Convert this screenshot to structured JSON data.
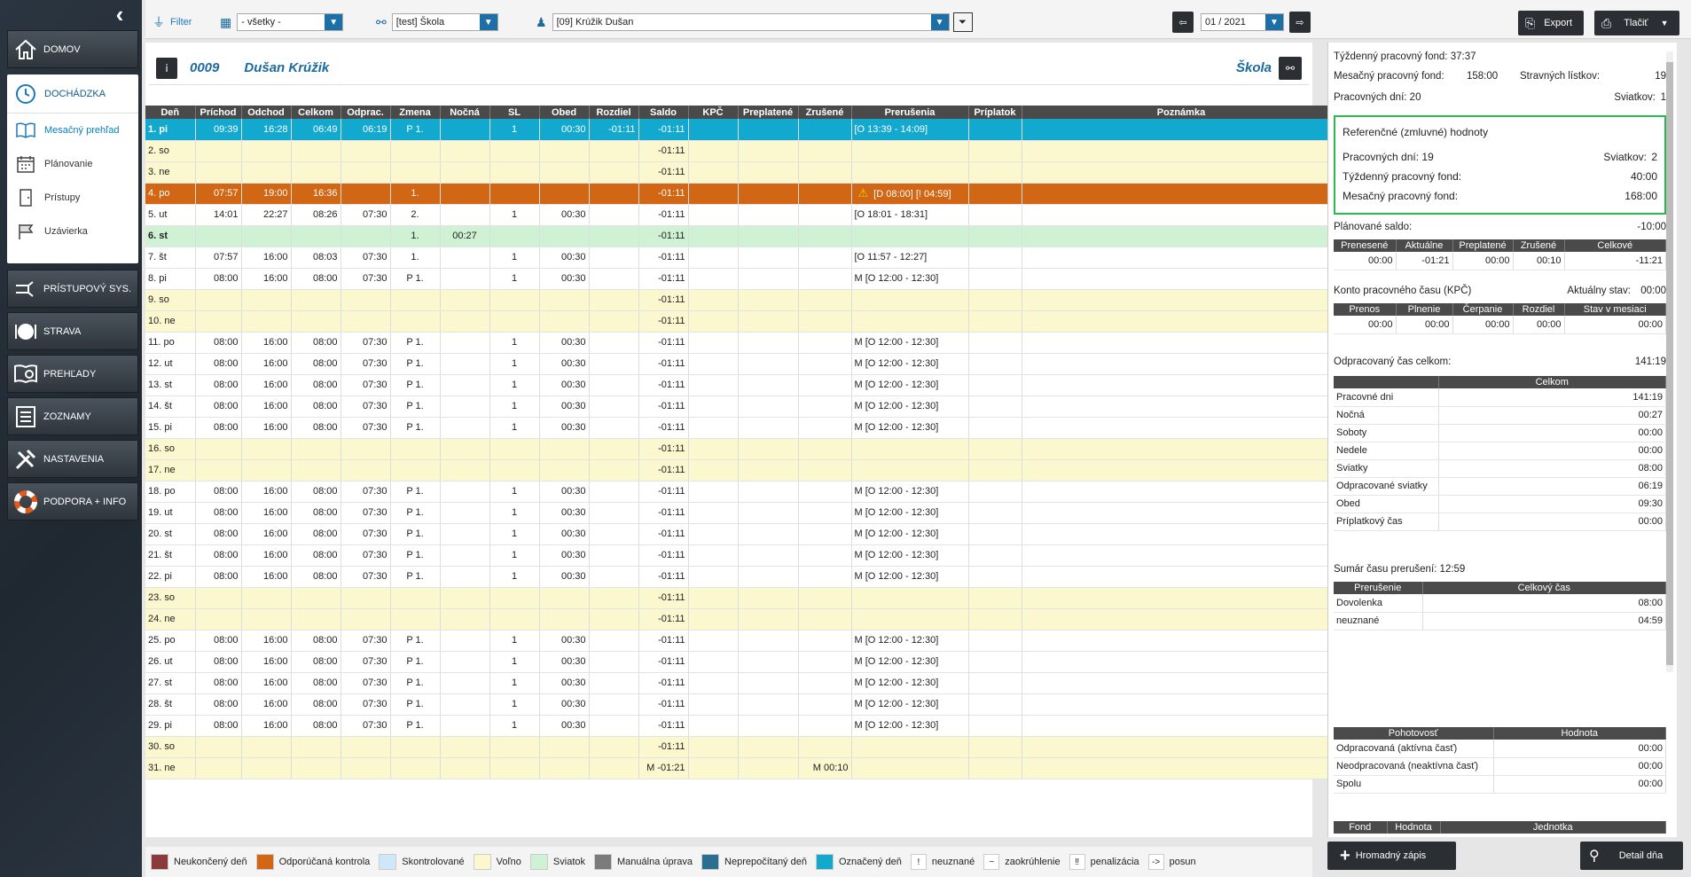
{
  "sidebar": {
    "collapse_icon": "chevron-left",
    "items": [
      {
        "label": "DOMOV",
        "icon": "home-icon"
      },
      {
        "label": "PRÍSTUPOVÝ SYS.",
        "icon": "access-icon"
      },
      {
        "label": "STRAVA",
        "icon": "plate-icon"
      },
      {
        "label": "PREHĽADY",
        "icon": "overview-icon"
      },
      {
        "label": "ZOZNAMY",
        "icon": "list-icon"
      },
      {
        "label": "NASTAVENIA",
        "icon": "tools-icon"
      },
      {
        "label": "PODPORA + INFO",
        "icon": "lifebuoy-icon"
      }
    ],
    "attendance": {
      "label": "DOCHÁDZKA",
      "sub": [
        {
          "label": "Mesačný prehľad",
          "icon": "book-icon"
        },
        {
          "label": "Plánovanie",
          "icon": "calendar-icon"
        },
        {
          "label": "Prístupy",
          "icon": "door-icon"
        },
        {
          "label": "Uzávierka",
          "icon": "flag-icon"
        }
      ]
    }
  },
  "toolbar": {
    "filter_label": "Filter",
    "dept_value": "- všetky -",
    "org_value": "[test] Škola",
    "employee_value": "[09] Krúžik Dušan",
    "month_value": "01 / 2021",
    "export_label": "Export",
    "print_label": "Tlačiť"
  },
  "employee": {
    "number": "0009",
    "name": "Dušan Krúžik",
    "org": "Škola"
  },
  "columns": [
    "Deň",
    "Príchod",
    "Odchod",
    "Celkom",
    "Odprac.",
    "Zmena",
    "Nočná",
    "SL",
    "Obed",
    "Rozdiel",
    "Saldo",
    "KPČ",
    "Preplatené",
    "Zrušené",
    "Prerušenia",
    "Príplatok",
    "Poznámka"
  ],
  "rows": [
    {
      "type": "marked",
      "cells": [
        "1. pi",
        "09:39",
        "16:28",
        "06:49",
        "06:19",
        "P 1.",
        "",
        "1",
        "00:30",
        "-01:11",
        "-01:11",
        "",
        "",
        "",
        "[O 13:39 - 14:09]",
        "",
        ""
      ]
    },
    {
      "type": "weekend",
      "cells": [
        "2. so",
        "",
        "",
        "",
        "",
        "",
        "",
        "",
        "",
        "",
        "-01:11",
        "",
        "",
        "",
        "",
        "",
        ""
      ]
    },
    {
      "type": "weekend",
      "cells": [
        "3. ne",
        "",
        "",
        "",
        "",
        "",
        "",
        "",
        "",
        "",
        "-01:11",
        "",
        "",
        "",
        "",
        "",
        ""
      ]
    },
    {
      "type": "orange",
      "cells": [
        "4. po",
        "07:57",
        "19:00",
        "16:36",
        "",
        "1.",
        "",
        "",
        "",
        "",
        "-01:11",
        "",
        "",
        "",
        "[D 08:00] [! 04:59]",
        "",
        ""
      ]
    },
    {
      "type": "normal",
      "cells": [
        "5. ut",
        "14:01",
        "22:27",
        "08:26",
        "07:30",
        "2.",
        "",
        "1",
        "00:30",
        "",
        "-01:11",
        "",
        "",
        "",
        "[O 18:01 - 18:31]",
        "",
        ""
      ]
    },
    {
      "type": "holiday",
      "cells": [
        "6. st",
        "",
        "",
        "",
        "",
        "1.",
        "00:27",
        "",
        "",
        "",
        "-01:11",
        "",
        "",
        "",
        "",
        "",
        ""
      ]
    },
    {
      "type": "normal",
      "cells": [
        "7. št",
        "07:57",
        "16:00",
        "08:03",
        "07:30",
        "1.",
        "",
        "1",
        "00:30",
        "",
        "-01:11",
        "",
        "",
        "",
        "[O 11:57 - 12:27]",
        "",
        ""
      ]
    },
    {
      "type": "normal",
      "cells": [
        "8. pi",
        "08:00",
        "16:00",
        "08:00",
        "07:30",
        "P 1.",
        "",
        "1",
        "00:30",
        "",
        "-01:11",
        "",
        "",
        "",
        "M [O 12:00 - 12:30]",
        "",
        ""
      ]
    },
    {
      "type": "weekend",
      "cells": [
        "9. so",
        "",
        "",
        "",
        "",
        "",
        "",
        "",
        "",
        "",
        "-01:11",
        "",
        "",
        "",
        "",
        "",
        ""
      ]
    },
    {
      "type": "weekend",
      "cells": [
        "10. ne",
        "",
        "",
        "",
        "",
        "",
        "",
        "",
        "",
        "",
        "-01:11",
        "",
        "",
        "",
        "",
        "",
        ""
      ]
    },
    {
      "type": "normal",
      "cells": [
        "11. po",
        "08:00",
        "16:00",
        "08:00",
        "07:30",
        "P 1.",
        "",
        "1",
        "00:30",
        "",
        "-01:11",
        "",
        "",
        "",
        "M [O 12:00 - 12:30]",
        "",
        ""
      ]
    },
    {
      "type": "normal",
      "cells": [
        "12. ut",
        "08:00",
        "16:00",
        "08:00",
        "07:30",
        "P 1.",
        "",
        "1",
        "00:30",
        "",
        "-01:11",
        "",
        "",
        "",
        "M [O 12:00 - 12:30]",
        "",
        ""
      ]
    },
    {
      "type": "normal",
      "cells": [
        "13. st",
        "08:00",
        "16:00",
        "08:00",
        "07:30",
        "P 1.",
        "",
        "1",
        "00:30",
        "",
        "-01:11",
        "",
        "",
        "",
        "M [O 12:00 - 12:30]",
        "",
        ""
      ]
    },
    {
      "type": "normal",
      "cells": [
        "14. št",
        "08:00",
        "16:00",
        "08:00",
        "07:30",
        "P 1.",
        "",
        "1",
        "00:30",
        "",
        "-01:11",
        "",
        "",
        "",
        "M [O 12:00 - 12:30]",
        "",
        ""
      ]
    },
    {
      "type": "normal",
      "cells": [
        "15. pi",
        "08:00",
        "16:00",
        "08:00",
        "07:30",
        "P 1.",
        "",
        "1",
        "00:30",
        "",
        "-01:11",
        "",
        "",
        "",
        "M [O 12:00 - 12:30]",
        "",
        ""
      ]
    },
    {
      "type": "weekend",
      "cells": [
        "16. so",
        "",
        "",
        "",
        "",
        "",
        "",
        "",
        "",
        "",
        "-01:11",
        "",
        "",
        "",
        "",
        "",
        ""
      ]
    },
    {
      "type": "weekend",
      "cells": [
        "17. ne",
        "",
        "",
        "",
        "",
        "",
        "",
        "",
        "",
        "",
        "-01:11",
        "",
        "",
        "",
        "",
        "",
        ""
      ]
    },
    {
      "type": "normal",
      "cells": [
        "18. po",
        "08:00",
        "16:00",
        "08:00",
        "07:30",
        "P 1.",
        "",
        "1",
        "00:30",
        "",
        "-01:11",
        "",
        "",
        "",
        "M [O 12:00 - 12:30]",
        "",
        ""
      ]
    },
    {
      "type": "normal",
      "cells": [
        "19. ut",
        "08:00",
        "16:00",
        "08:00",
        "07:30",
        "P 1.",
        "",
        "1",
        "00:30",
        "",
        "-01:11",
        "",
        "",
        "",
        "M [O 12:00 - 12:30]",
        "",
        ""
      ]
    },
    {
      "type": "normal",
      "cells": [
        "20. st",
        "08:00",
        "16:00",
        "08:00",
        "07:30",
        "P 1.",
        "",
        "1",
        "00:30",
        "",
        "-01:11",
        "",
        "",
        "",
        "M [O 12:00 - 12:30]",
        "",
        ""
      ]
    },
    {
      "type": "normal",
      "cells": [
        "21. št",
        "08:00",
        "16:00",
        "08:00",
        "07:30",
        "P 1.",
        "",
        "1",
        "00:30",
        "",
        "-01:11",
        "",
        "",
        "",
        "M [O 12:00 - 12:30]",
        "",
        ""
      ]
    },
    {
      "type": "normal",
      "cells": [
        "22. pi",
        "08:00",
        "16:00",
        "08:00",
        "07:30",
        "P 1.",
        "",
        "1",
        "00:30",
        "",
        "-01:11",
        "",
        "",
        "",
        "M [O 12:00 - 12:30]",
        "",
        ""
      ]
    },
    {
      "type": "weekend",
      "cells": [
        "23. so",
        "",
        "",
        "",
        "",
        "",
        "",
        "",
        "",
        "",
        "-01:11",
        "",
        "",
        "",
        "",
        "",
        ""
      ]
    },
    {
      "type": "weekend",
      "cells": [
        "24. ne",
        "",
        "",
        "",
        "",
        "",
        "",
        "",
        "",
        "",
        "-01:11",
        "",
        "",
        "",
        "",
        "",
        ""
      ]
    },
    {
      "type": "normal",
      "cells": [
        "25. po",
        "08:00",
        "16:00",
        "08:00",
        "07:30",
        "P 1.",
        "",
        "1",
        "00:30",
        "",
        "-01:11",
        "",
        "",
        "",
        "M [O 12:00 - 12:30]",
        "",
        ""
      ]
    },
    {
      "type": "normal",
      "cells": [
        "26. ut",
        "08:00",
        "16:00",
        "08:00",
        "07:30",
        "P 1.",
        "",
        "1",
        "00:30",
        "",
        "-01:11",
        "",
        "",
        "",
        "M [O 12:00 - 12:30]",
        "",
        ""
      ]
    },
    {
      "type": "normal",
      "cells": [
        "27. st",
        "08:00",
        "16:00",
        "08:00",
        "07:30",
        "P 1.",
        "",
        "1",
        "00:30",
        "",
        "-01:11",
        "",
        "",
        "",
        "M [O 12:00 - 12:30]",
        "",
        ""
      ]
    },
    {
      "type": "normal",
      "cells": [
        "28. št",
        "08:00",
        "16:00",
        "08:00",
        "07:30",
        "P 1.",
        "",
        "1",
        "00:30",
        "",
        "-01:11",
        "",
        "",
        "",
        "M [O 12:00 - 12:30]",
        "",
        ""
      ]
    },
    {
      "type": "normal",
      "cells": [
        "29. pi",
        "08:00",
        "16:00",
        "08:00",
        "07:30",
        "P 1.",
        "",
        "1",
        "00:30",
        "",
        "-01:11",
        "",
        "",
        "",
        "M [O 12:00 - 12:30]",
        "",
        ""
      ]
    },
    {
      "type": "weekend",
      "cells": [
        "30. so",
        "",
        "",
        "",
        "",
        "",
        "",
        "",
        "",
        "",
        "-01:11",
        "",
        "",
        "",
        "",
        "",
        ""
      ]
    },
    {
      "type": "weekend",
      "cells": [
        "31. ne",
        "",
        "",
        "",
        "",
        "",
        "",
        "",
        "",
        "",
        "M   -01:21",
        "",
        "",
        "M   00:10",
        "",
        "",
        ""
      ]
    }
  ],
  "summary": {
    "weekly_fund_label": "Týždenný pracovný fond:",
    "weekly_fund": "37:37",
    "monthly_fund_label": "Mesačný pracovný fond:",
    "monthly_fund": "158:00",
    "meal_label": "Stravných lístkov:",
    "meal": "19",
    "workdays_label": "Pracovných dní:",
    "workdays": "20",
    "holidays_label": "Sviatkov:",
    "holidays": "1",
    "ref_title": "Referenčné (zmluvné) hodnoty",
    "ref_workdays_label": "Pracovných dní:",
    "ref_workdays": "19",
    "ref_holidays_label": "Sviatkov:",
    "ref_holidays": "2",
    "ref_weekly_label": "Týždenný pracovný fond:",
    "ref_weekly": "40:00",
    "ref_monthly_label": "Mesačný pracovný fond:",
    "ref_monthly": "168:00",
    "planned_label": "Plánované saldo:",
    "planned": "-10:00",
    "saldo_cols": [
      "Prenesené",
      "Aktuálne",
      "Preplatené",
      "Zrušené",
      "Celkové"
    ],
    "saldo_vals": [
      "00:00",
      "-01:21",
      "00:00",
      "00:10",
      "-11:21"
    ],
    "kpc_label": "Konto pracovného času (KPČ)",
    "kpc_state_label": "Aktuálny stav:",
    "kpc_state": "00:00",
    "kpc_cols": [
      "Prenos",
      "Plnenie",
      "Čerpanie",
      "Rozdiel",
      "Stav v mesiaci"
    ],
    "kpc_vals": [
      "00:00",
      "00:00",
      "00:00",
      "00:00",
      "00:00"
    ],
    "worked_label": "Odpracovaný čas celkom:",
    "worked": "141:19",
    "total_col": "Celkom",
    "totals": [
      [
        "Pracovné dni",
        "141:19"
      ],
      [
        "Nočná",
        "00:27"
      ],
      [
        "Soboty",
        "00:00"
      ],
      [
        "Nedele",
        "00:00"
      ],
      [
        "Sviatky",
        "08:00"
      ],
      [
        "Odpracované sviatky",
        "06:19"
      ],
      [
        "Obed",
        "09:30"
      ],
      [
        "Príplatkový čas",
        "00:00"
      ]
    ],
    "breaks_label": "Sumár času prerušení:",
    "breaks": "12:59",
    "breaks_cols": [
      "Prerušenie",
      "Celkový čas"
    ],
    "breaks_rows": [
      [
        "Dovolenka",
        "08:00"
      ],
      [
        "neuznané",
        "04:59"
      ]
    ],
    "standby_cols": [
      "Pohotovosť",
      "Hodnota"
    ],
    "standby_rows": [
      [
        "Odpracovaná (aktívna časť)",
        "00:00"
      ],
      [
        "Neodpracovaná (neaktívna časť)",
        "00:00"
      ],
      [
        "Spolu",
        "00:00"
      ]
    ],
    "fund_cols": [
      "Fond",
      "Hodnota",
      "Jednotka"
    ]
  },
  "legend": [
    {
      "label": "Neukončený deň",
      "color": "#8b3a3a"
    },
    {
      "label": "Odporúčaná kontrola",
      "color": "#d16614"
    },
    {
      "label": "Skontrolované",
      "color": "#cfe8f7"
    },
    {
      "label": "Voľno",
      "color": "#fbf7cf"
    },
    {
      "label": "Sviatok",
      "color": "#cff2d4"
    },
    {
      "label": "Manuálna úprava",
      "color": "#7b7b7b"
    },
    {
      "label": "Neprepočítaný deň",
      "color": "#2a6f8f"
    },
    {
      "label": "Označený deň",
      "color": "#13a9cf"
    }
  ],
  "legend_symbols": [
    {
      "sym": "!",
      "label": "neuznané"
    },
    {
      "sym": "~",
      "label": "zaokrúhlenie"
    },
    {
      "sym": "‼",
      "label": "penalizácia"
    },
    {
      "sym": "->",
      "label": "posun"
    }
  ],
  "bottom": {
    "bulk_label": "Hromadný zápis",
    "detail_label": "Detail dňa"
  }
}
